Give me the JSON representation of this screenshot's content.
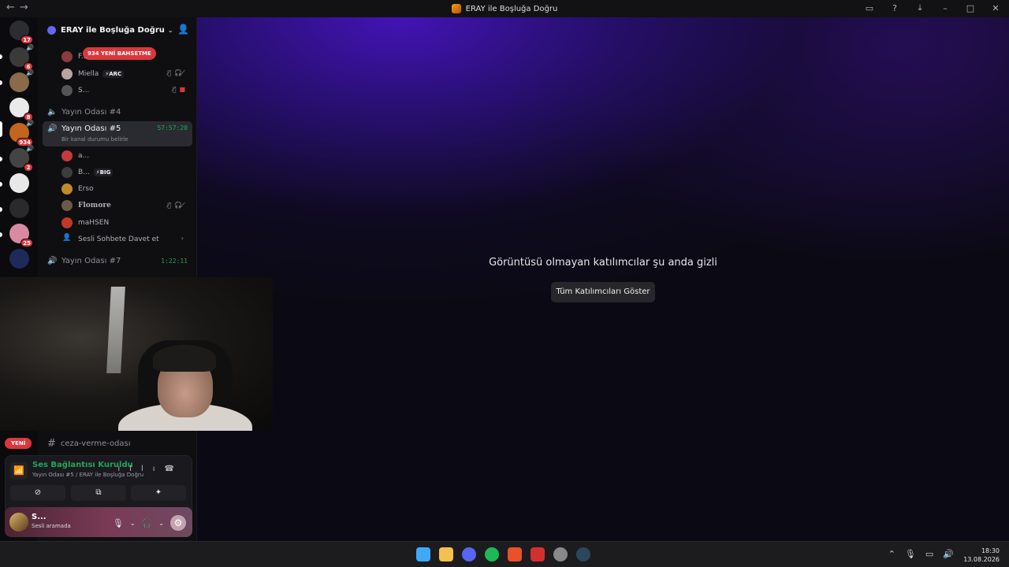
{
  "titlebar": {
    "title": "ERAY ile Boşluğa Doğru",
    "back": "←",
    "forward": "→"
  },
  "rail": {
    "servers": [
      {
        "name": "discord-home",
        "badge": "17",
        "color": "#2b2d31"
      },
      {
        "name": "server-2",
        "badge": "6",
        "color": "#3a3a3a"
      },
      {
        "name": "server-3",
        "badge": "",
        "color": "#8a6a4a"
      },
      {
        "name": "server-4",
        "badge": "8",
        "color": "#eaeaea"
      },
      {
        "name": "server-5",
        "badge": "934",
        "color": "#c2651f"
      },
      {
        "name": "server-6",
        "badge": "2",
        "color": "#444"
      },
      {
        "name": "server-7",
        "badge": "",
        "color": "#e8e8e8"
      },
      {
        "name": "server-8",
        "badge": "",
        "color": "#2a2a2a"
      },
      {
        "name": "server-9",
        "badge": "25",
        "color": "#d98aa2"
      },
      {
        "name": "server-10",
        "badge": "",
        "color": "#1e2a5a"
      }
    ]
  },
  "server": {
    "name": "ERAY ile Boşluğa Doğru",
    "mention_pill": "934 YENİ BAHSETME"
  },
  "channels": {
    "top_users": [
      {
        "name": "F...",
        "tag": "",
        "color": "#8a3b3b"
      },
      {
        "name": "Miella",
        "tag": "⚡ARC",
        "color": "#b9a5a0"
      },
      {
        "name": "S...",
        "tag": "",
        "color": "#555"
      }
    ],
    "room4": "Yayın Odası #4",
    "room5": {
      "name": "Yayın Odası #5",
      "timer": "57:57:20",
      "status": "Bir kanal durumu belirle"
    },
    "room5_users": [
      {
        "name": "a...",
        "tag": "",
        "color": "#c43a3a"
      },
      {
        "name": "B...",
        "tag": "⚡BIG",
        "color": "#3c3c3c"
      },
      {
        "name": "Erso",
        "tag": "",
        "color": "#c28a2a"
      },
      {
        "name": "Flomore",
        "tag": "",
        "color": "#6a5a4a"
      },
      {
        "name": "maHSEN",
        "tag": "",
        "color": "#c0392b"
      }
    ],
    "invite": "Sesli Sohbete Davet et",
    "room7": {
      "name": "Yayın Odası #7",
      "timer": "1:22:11"
    },
    "text_channel": "ceza-verme-odası",
    "new_pill": "YENİ"
  },
  "voice_panel": {
    "status": "Ses Bağlantısı Kuruldu",
    "sub": "Yayın Odası #5 / ERAY ile Boşluğa Doğru"
  },
  "user_panel": {
    "name": "S...",
    "sub": "Sesli aramada"
  },
  "stage": {
    "message": "Görüntüsü olmayan katılımcılar şu anda gizli",
    "button": "Tüm Katılımcıları Göster"
  },
  "taskbar": {
    "time": "18:30",
    "date": "13.08.2026",
    "apps": [
      {
        "name": "windows-start-icon",
        "color": "#3fa9f5"
      },
      {
        "name": "file-explorer-icon",
        "color": "#f2c14e"
      },
      {
        "name": "discord-icon",
        "color": "#5865f2"
      },
      {
        "name": "spotify-icon",
        "color": "#1db954"
      },
      {
        "name": "brave-icon",
        "color": "#e8522a"
      },
      {
        "name": "app-red-icon",
        "color": "#d32f2f"
      },
      {
        "name": "app-circle-icon",
        "color": "#888"
      },
      {
        "name": "steam-icon",
        "color": "#2a475e"
      }
    ]
  }
}
